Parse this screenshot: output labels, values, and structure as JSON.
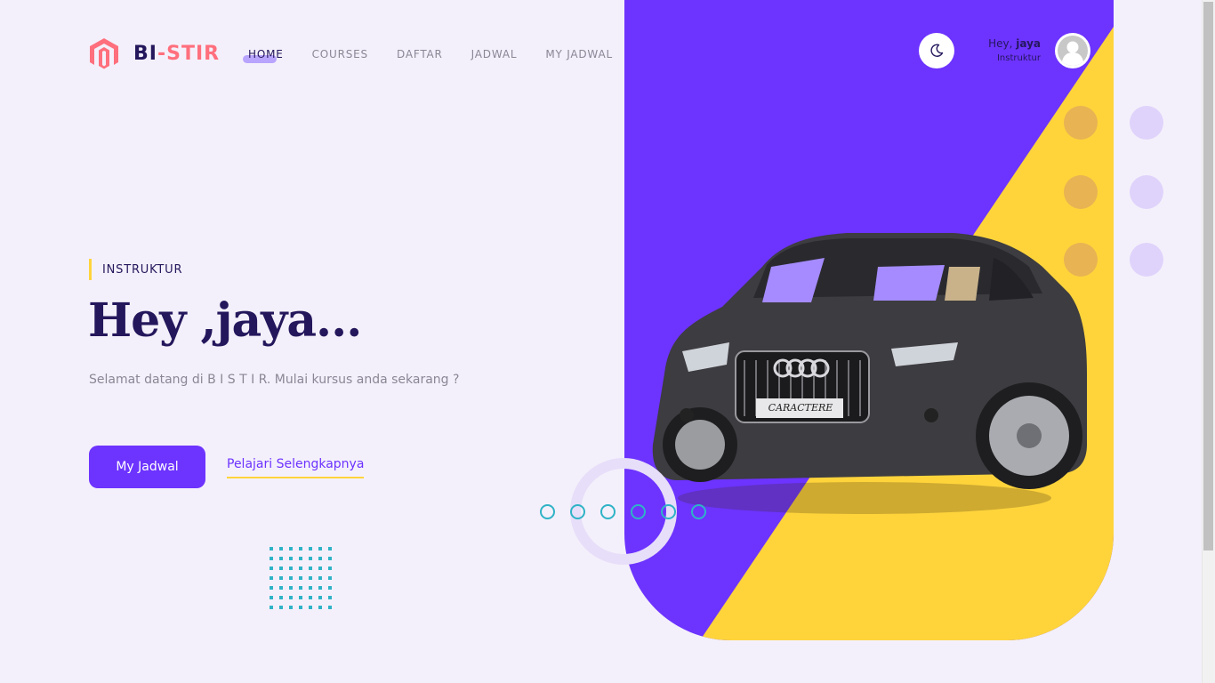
{
  "brand": {
    "part1": "BI",
    "part2": "-STIR"
  },
  "nav": {
    "items": [
      {
        "label": "HOME",
        "active": true
      },
      {
        "label": "COURSES",
        "active": false
      },
      {
        "label": "DAFTAR",
        "active": false
      },
      {
        "label": "JADWAL",
        "active": false
      },
      {
        "label": "MY JADWAL",
        "active": false
      }
    ]
  },
  "user": {
    "greeting": "Hey,",
    "name": "jaya",
    "role": "Instruktur"
  },
  "hero": {
    "tagline": "INSTRUKTUR",
    "title": "Hey ,jaya...",
    "subtitle": "Selamat datang di B I S T I R. Mulai kursus anda sekarang ?",
    "primary_button": "My Jadwal",
    "secondary_link": "Pelajari Selengkapnya",
    "car_plate": "CARACTERE"
  },
  "colors": {
    "primary": "#6d33ff",
    "accent_yellow": "#ffd43b",
    "logo_red": "#ff6f7d",
    "heading": "#25175c",
    "muted": "#8a8796",
    "teal": "#2fb3c6"
  },
  "icons": [
    "logo-icon",
    "moon-icon",
    "avatar-icon"
  ]
}
